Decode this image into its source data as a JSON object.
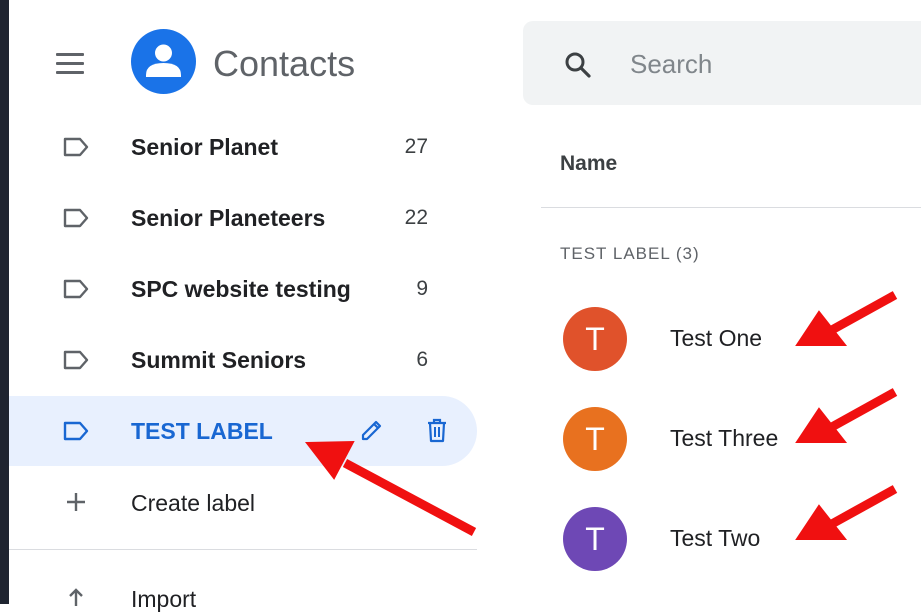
{
  "app": {
    "title": "Contacts"
  },
  "search": {
    "placeholder": "Search",
    "value": ""
  },
  "labels": [
    {
      "name": "Senior Planet",
      "count": "27"
    },
    {
      "name": "Senior Planeteers",
      "count": "22"
    },
    {
      "name": "SPC website testing",
      "count": "9"
    },
    {
      "name": "Summit Seniors",
      "count": "6"
    },
    {
      "name": "TEST LABEL",
      "count": "",
      "active": true
    }
  ],
  "create_label": "Create label",
  "import": "Import",
  "table": {
    "column_name": "Name",
    "group_heading": "TEST LABEL (3)"
  },
  "contacts": [
    {
      "initial": "T",
      "name": "Test One",
      "color": "#e0522b"
    },
    {
      "initial": "T",
      "name": "Test Three",
      "color": "#e8711f"
    },
    {
      "initial": "T",
      "name": "Test Two",
      "color": "#6e48b5"
    }
  ],
  "colors": {
    "accent": "#1a73e8",
    "active_bg": "#e8f0fe",
    "active_text": "#1967d2",
    "annotation_arrow": "#f01010"
  },
  "icons": {
    "menu": "hamburger-menu-icon",
    "logo": "person-icon",
    "label": "label-outline-icon",
    "edit": "pencil-icon",
    "delete": "trash-icon",
    "add": "plus-icon",
    "import": "upload-icon",
    "search": "search-icon"
  }
}
